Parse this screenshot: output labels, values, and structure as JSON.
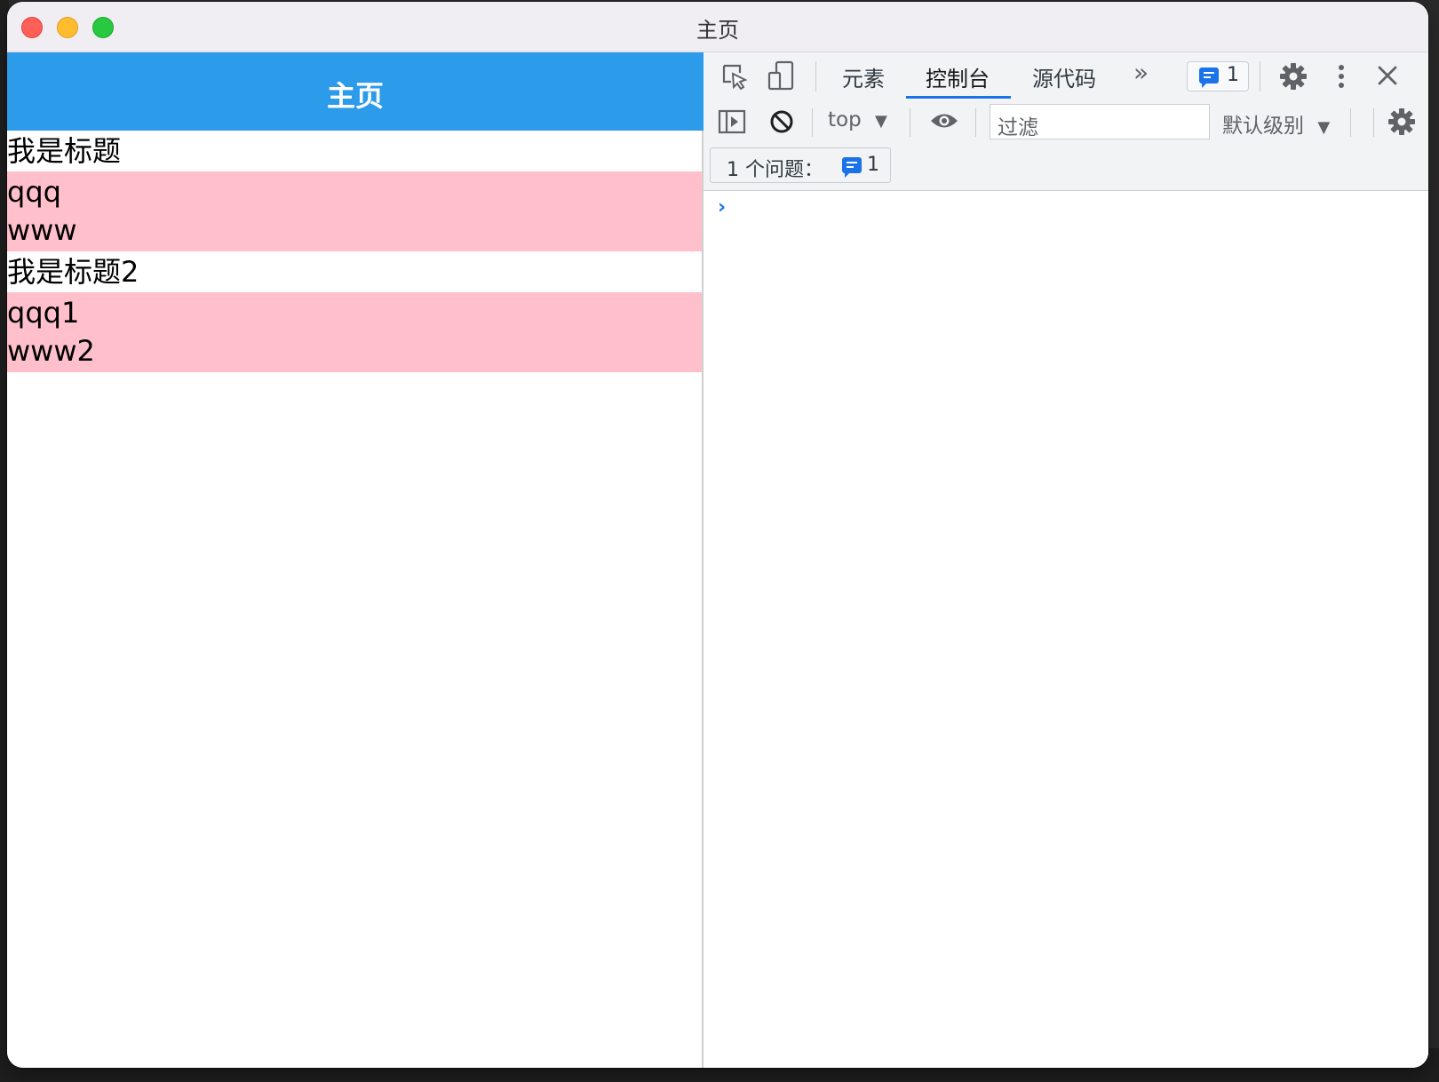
{
  "window": {
    "title": "主页"
  },
  "app": {
    "nav_title": "主页",
    "sections": [
      {
        "title": "我是标题",
        "items": [
          "qqq",
          "www"
        ]
      },
      {
        "title": "我是标题2",
        "items": [
          "qqq1",
          "www2"
        ]
      }
    ],
    "section_body_color": "#ffc0cb",
    "nav_color": "#2b9bea"
  },
  "devtools": {
    "tabs": [
      {
        "label": "元素",
        "active": false
      },
      {
        "label": "控制台",
        "active": true
      },
      {
        "label": "源代码",
        "active": false
      }
    ],
    "more_tabs_icon": "»",
    "issues_badge_count": "1",
    "context_select": "top",
    "filter_placeholder": "过滤",
    "level_select": "默认级别",
    "issues_bar_label": "1 个问题：",
    "issues_bar_count": "1",
    "prompt_symbol": "›",
    "accent_color": "#1a73e8"
  }
}
